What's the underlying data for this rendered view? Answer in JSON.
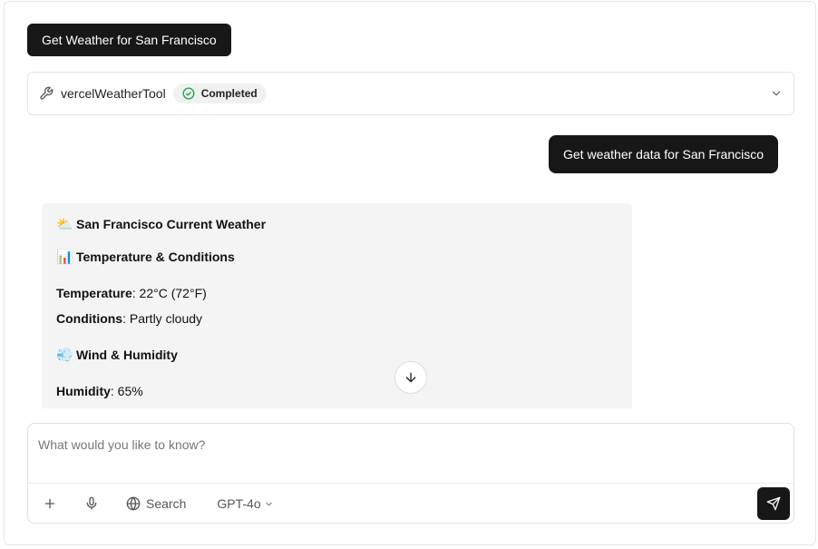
{
  "top_action": {
    "label": "Get Weather for San Francisco"
  },
  "tool_call": {
    "name": "vercelWeatherTool",
    "status": "Completed"
  },
  "user_message": {
    "text": "Get weather data for San Francisco"
  },
  "assistant_message": {
    "title_emoji": "⛅",
    "title": "San Francisco Current Weather",
    "section1_emoji": "📊",
    "section1_title": "Temperature & Conditions",
    "temperature_label": "Temperature",
    "temperature_value": ": 22°C (72°F)",
    "conditions_label": "Conditions",
    "conditions_value": ": Partly cloudy",
    "section2_emoji": "💨",
    "section2_title": "Wind & Humidity",
    "humidity_label": "Humidity",
    "humidity_value": ": 65%"
  },
  "composer": {
    "placeholder": "What would you like to know?",
    "search_label": "Search",
    "model_label": "GPT-4o"
  },
  "icons": {
    "tool": "wrench-icon",
    "status": "check-circle-icon",
    "expand": "chevron-down-icon",
    "scroll": "arrow-down-icon",
    "attach": "plus-icon",
    "voice": "mic-icon",
    "search": "globe-icon",
    "model": "chevron-down-icon",
    "send": "send-icon"
  },
  "colors": {
    "primary_button": "#171717",
    "status_green": "#16a34a",
    "assistant_bg": "#f4f4f4"
  }
}
